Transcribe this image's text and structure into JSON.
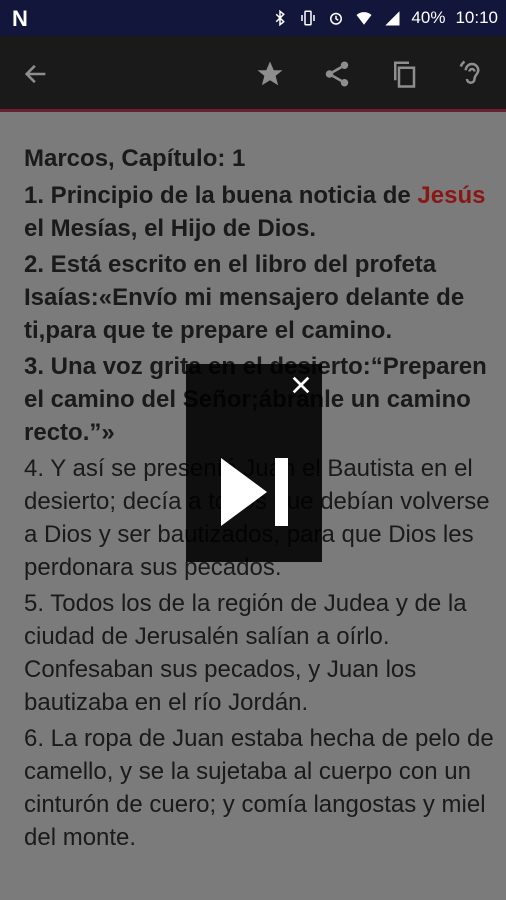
{
  "status_bar": {
    "carrier_icon": "N",
    "battery_percent": "40%",
    "time": "10:10"
  },
  "toolbar": {
    "back_icon": "arrow-left",
    "actions": [
      "star-icon",
      "share-icon",
      "copy-icon",
      "hearing-icon"
    ]
  },
  "reading": {
    "chapter_title": "Marcos, Capítulo: 1",
    "verses": [
      {
        "pre": "1. Principio de la buena noticia de ",
        "highlight": "Jesús",
        "post": " el Mesías, el Hijo de Dios."
      },
      {
        "text": "2. Está escrito en el libro del profeta Isaías:«Envío mi mensajero delante de ti,para que te prepare el camino."
      },
      {
        "text": "3. Una voz grita en el desierto:“Preparen el camino del Señor;ábranle un camino recto.”»"
      },
      {
        "text": "4. Y así se presentó Juan el Bautista en el desierto; decía a todos que debían volverse a Dios y ser bautizados, para que Dios les perdonara sus pecados."
      },
      {
        "text": "5. Todos los de la región de Judea y de la ciudad de Jerusalén salían a oírlo. Confesaban sus pecados, y Juan los bautizaba en el río Jordán."
      },
      {
        "text": "6. La ropa de Juan estaba hecha de pelo de camello, y se la sujetaba al cuerpo con un cinturón de cuero; y comía langostas y miel del monte."
      }
    ]
  },
  "overlay": {
    "close_icon": "close-icon",
    "skip_icon": "skip-next-icon"
  },
  "colors": {
    "status_bar": "#12163a",
    "toolbar": "#1a1a1a",
    "accent_line": "#6b1f33",
    "highlight": "#8a1616",
    "dim_background": "#7b7b7b"
  }
}
